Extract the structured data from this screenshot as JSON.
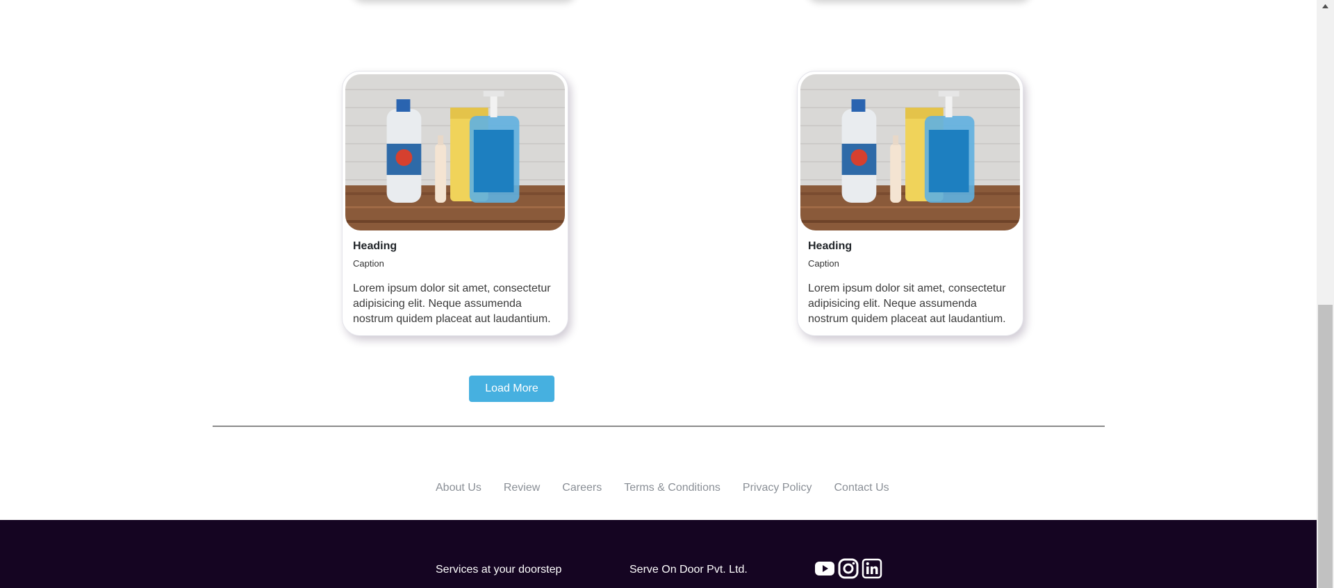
{
  "cards": [
    {
      "heading": "Heading",
      "caption": "Caption",
      "text": "Lorem ipsum dolor sit amet, consectetur adipisicing elit. Neque assumenda nostrum quidem placeat aut laudantium.",
      "image_alt": "cleaning supplies photo"
    },
    {
      "heading": "Heading",
      "caption": "Caption",
      "text": "Lorem ipsum dolor sit amet, consectetur adipisicing elit. Neque assumenda nostrum quidem placeat aut laudantium.",
      "image_alt": "cleaning supplies photo"
    }
  ],
  "load_more_label": "Load More",
  "footer_links": [
    "About Us",
    "Review",
    "Careers",
    "Terms & Conditions",
    "Privacy Policy",
    "Contact Us"
  ],
  "footer": {
    "tagline": "Services at your doorstep",
    "company": "Serve On Door Pvt. Ltd.",
    "socials": [
      "youtube-icon",
      "instagram-icon",
      "linkedin-icon"
    ]
  },
  "colors": {
    "button": "#46b0e0",
    "footer_bg": "#150522",
    "link": "#8a8f96"
  }
}
